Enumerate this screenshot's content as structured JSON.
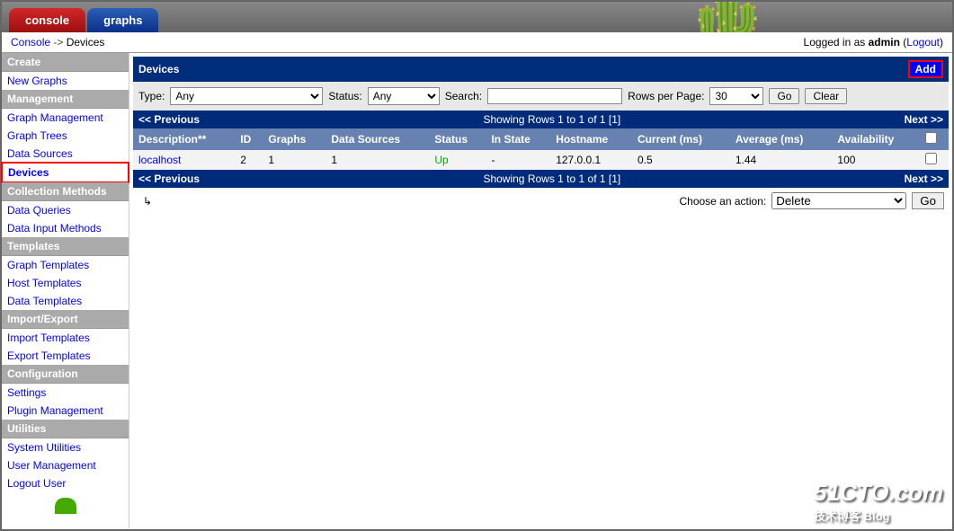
{
  "tabs": {
    "console": "console",
    "graphs": "graphs"
  },
  "breadcrumb": {
    "console": "Console",
    "sep": " -> ",
    "current": "Devices"
  },
  "login": {
    "text": "Logged in as ",
    "user": "admin",
    "logout": "Logout"
  },
  "sidebar": {
    "groups": [
      {
        "header": "Create",
        "items": [
          {
            "label": "New Graphs",
            "id": "new-graphs"
          }
        ]
      },
      {
        "header": "Management",
        "items": [
          {
            "label": "Graph Management",
            "id": "graph-management"
          },
          {
            "label": "Graph Trees",
            "id": "graph-trees"
          },
          {
            "label": "Data Sources",
            "id": "data-sources"
          },
          {
            "label": "Devices",
            "id": "devices",
            "selected": true
          }
        ]
      },
      {
        "header": "Collection Methods",
        "items": [
          {
            "label": "Data Queries",
            "id": "data-queries"
          },
          {
            "label": "Data Input Methods",
            "id": "data-input-methods"
          }
        ]
      },
      {
        "header": "Templates",
        "items": [
          {
            "label": "Graph Templates",
            "id": "graph-templates"
          },
          {
            "label": "Host Templates",
            "id": "host-templates"
          },
          {
            "label": "Data Templates",
            "id": "data-templates"
          }
        ]
      },
      {
        "header": "Import/Export",
        "items": [
          {
            "label": "Import Templates",
            "id": "import-templates"
          },
          {
            "label": "Export Templates",
            "id": "export-templates"
          }
        ]
      },
      {
        "header": "Configuration",
        "items": [
          {
            "label": "Settings",
            "id": "settings"
          },
          {
            "label": "Plugin Management",
            "id": "plugin-management"
          }
        ]
      },
      {
        "header": "Utilities",
        "items": [
          {
            "label": "System Utilities",
            "id": "system-utilities"
          },
          {
            "label": "User Management",
            "id": "user-management"
          },
          {
            "label": "Logout User",
            "id": "logout-user"
          }
        ]
      }
    ]
  },
  "panel": {
    "title": "Devices",
    "add": "Add",
    "filter": {
      "type_label": "Type:",
      "type_value": "Any",
      "status_label": "Status:",
      "status_value": "Any",
      "search_label": "Search:",
      "search_value": "",
      "rpp_label": "Rows per Page:",
      "rpp_value": "30",
      "go": "Go",
      "clear": "Clear"
    },
    "pager": {
      "prev": "<< Previous",
      "info": "Showing Rows 1 to 1 of 1 [1]",
      "next": "Next >>"
    },
    "columns": [
      "Description**",
      "ID",
      "Graphs",
      "Data Sources",
      "Status",
      "In State",
      "Hostname",
      "Current (ms)",
      "Average (ms)",
      "Availability"
    ],
    "rows": [
      {
        "description": "localhost",
        "id": "2",
        "graphs": "1",
        "data_sources": "1",
        "status": "Up",
        "in_state": "-",
        "hostname": "127.0.0.1",
        "current": "0.5",
        "average": "1.44",
        "availability": "100"
      }
    ],
    "action": {
      "label": "Choose an action:",
      "selected": "Delete",
      "go": "Go"
    }
  },
  "watermark": {
    "main": "51CTO.com",
    "sub": "技术博客   Blog"
  }
}
